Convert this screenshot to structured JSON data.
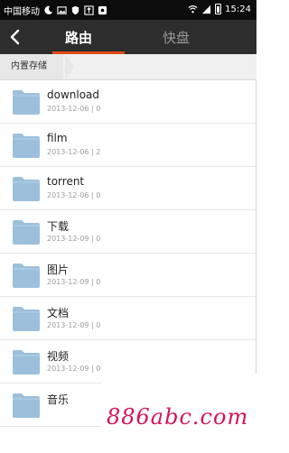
{
  "status_bar": {
    "carrier": "中国移动",
    "time": "15:24",
    "icons": [
      "moon-icon",
      "image-icon",
      "shield-icon",
      "usb-icon",
      "app-icon",
      "wifi-icon",
      "signal-icon",
      "battery-icon"
    ]
  },
  "header": {
    "back_icon": "chevron-left-icon",
    "tabs": [
      {
        "label": "路由",
        "active": true
      },
      {
        "label": "快盘",
        "active": false
      }
    ],
    "accent_color": "#e04a16"
  },
  "breadcrumb": {
    "label": "内置存储"
  },
  "files": [
    {
      "name": "download",
      "meta": "2013-12-06 | 0"
    },
    {
      "name": "film",
      "meta": "2013-12-06 | 2"
    },
    {
      "name": "torrent",
      "meta": "2013-12-06 | 0"
    },
    {
      "name": "下载",
      "meta": "2013-12-09 | 0"
    },
    {
      "name": "图片",
      "meta": "2013-12-09 | 0"
    },
    {
      "name": "文档",
      "meta": "2013-12-09 | 0"
    },
    {
      "name": "视频",
      "meta": "2013-12-09 | 0"
    },
    {
      "name": "音乐",
      "meta": ""
    }
  ],
  "folder_color": "#9cc0dc",
  "watermark": {
    "text": "886abc.com",
    "color": "#d4145a"
  }
}
